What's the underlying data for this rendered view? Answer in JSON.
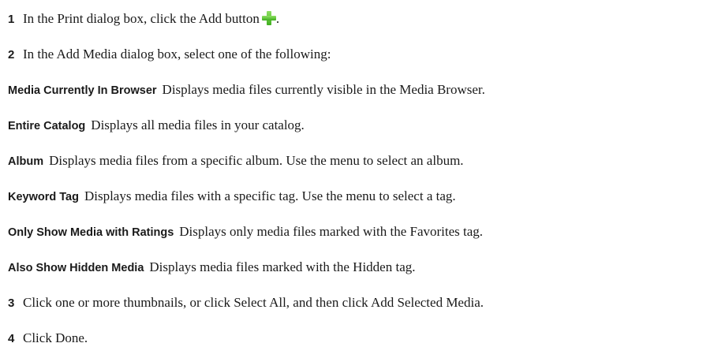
{
  "steps": {
    "step1": {
      "num": "1",
      "text": "In the Print dialog box, click the Add button",
      "after": "."
    },
    "step2": {
      "num": "2",
      "text": "In the Add Media dialog box, select one of the following:"
    },
    "step3": {
      "num": "3",
      "text": "Click one or more thumbnails, or click Select All, and then click Add Selected Media."
    },
    "step4": {
      "num": "4",
      "text": "Click Done."
    }
  },
  "options": [
    {
      "term": "Media Currently In Browser",
      "desc": "Displays media files currently visible in the Media Browser."
    },
    {
      "term": "Entire Catalog",
      "desc": "Displays all media files in your catalog."
    },
    {
      "term": "Album",
      "desc": "Displays media files from a specific album. Use the menu to select an album."
    },
    {
      "term": "Keyword Tag",
      "desc": "Displays media files with a specific tag. Use the menu to select a tag."
    },
    {
      "term": "Only Show Media with Ratings",
      "desc": "Displays only media files marked with the Favorites tag."
    },
    {
      "term": "Also Show Hidden Media",
      "desc": "Displays media files marked with the Hidden tag."
    }
  ],
  "icons": {
    "add": "plus-icon",
    "add_color": "#4cbb2a"
  }
}
